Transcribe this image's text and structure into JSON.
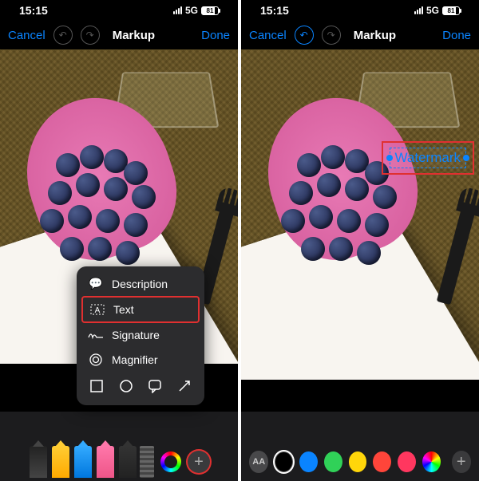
{
  "status": {
    "time": "15:15",
    "network": "5G",
    "battery": "81"
  },
  "nav": {
    "cancel": "Cancel",
    "title": "Markup",
    "done": "Done"
  },
  "popup": {
    "description": "Description",
    "text": "Text",
    "signature": "Signature",
    "magnifier": "Magnifier"
  },
  "watermark": {
    "text": "Watermark"
  },
  "colors": {
    "black": "#000000",
    "blue": "#0a84ff",
    "green": "#30d158",
    "yellow": "#ffd60a",
    "red": "#ff453a",
    "pinkred": "#ff375f"
  }
}
